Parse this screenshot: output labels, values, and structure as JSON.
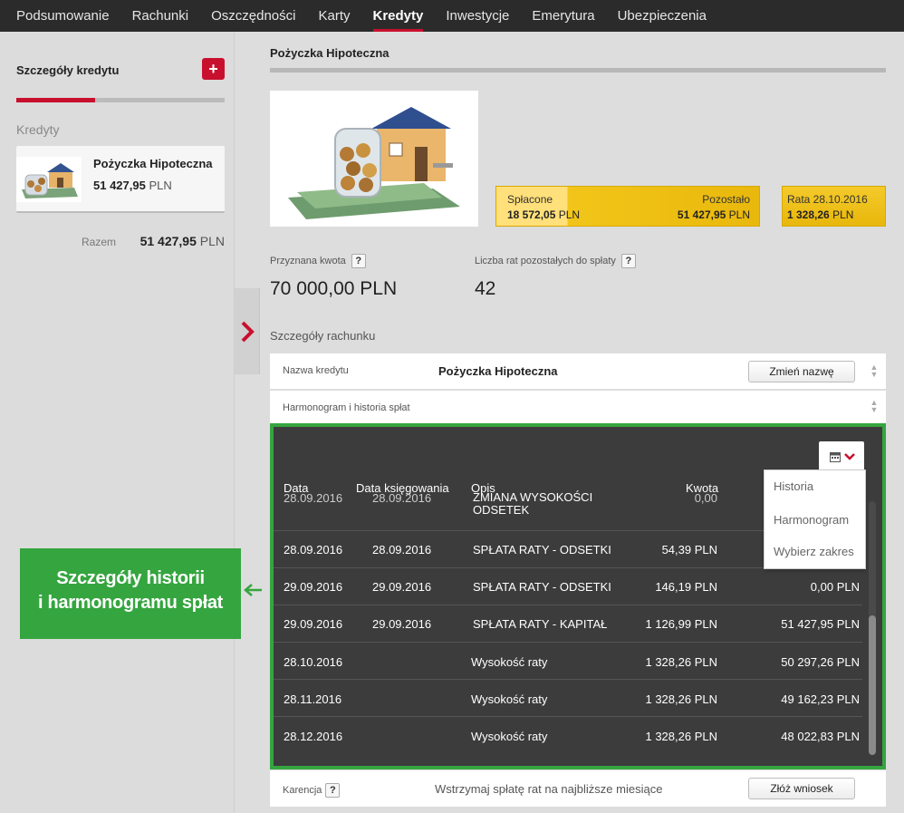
{
  "nav": {
    "items": [
      "Podsumowanie",
      "Rachunki",
      "Oszczędności",
      "Karty",
      "Kredyty",
      "Inwestycje",
      "Emerytura",
      "Ubezpieczenia"
    ],
    "active_index": 4
  },
  "sidebar": {
    "title": "Szczegóły kredytu",
    "add_icon": "plus-icon",
    "add_label": "+",
    "section": "Kredyty",
    "loan": {
      "name": "Pożyczka Hipoteczna",
      "amount": "51 427,95",
      "currency": "PLN"
    },
    "total": {
      "label": "Razem",
      "amount": "51 427,95",
      "currency": "PLN"
    }
  },
  "main": {
    "title": "Pożyczka Hipoteczna",
    "repayment": {
      "paid_label": "Spłacone",
      "paid_amount": "18 572,05",
      "remaining_label": "Pozostało",
      "remaining_amount": "51 427,95",
      "currency": "PLN",
      "paid_fraction": 0.27
    },
    "next_rate": {
      "label": "Rata 28.10.2016",
      "amount": "1 328,26",
      "currency": "PLN"
    },
    "granted": {
      "label": "Przyznana kwota",
      "value": "70 000,00 PLN"
    },
    "installments": {
      "label": "Liczba rat pozostałych do spłaty",
      "value": "42"
    },
    "account_details_label": "Szczegóły rachunku",
    "loan_name": {
      "label": "Nazwa kredytu",
      "value": "Pożyczka Hipoteczna",
      "button": "Zmień nazwę"
    },
    "history_label": "Harmonogram i historia spłat",
    "table": {
      "headers": [
        "Data",
        "Data księgowania",
        "Opis",
        "Kwota"
      ],
      "rows": [
        {
          "date": "28.09.2016",
          "booking": "28.09.2016",
          "desc": "ZMIANA WYSOKOŚCI ODSETEK",
          "amount": "0,00",
          "balance": ""
        },
        {
          "date": "28.09.2016",
          "booking": "28.09.2016",
          "desc": "SPŁATA RATY - ODSETKI",
          "amount": "54,39 PLN",
          "balance": ""
        },
        {
          "date": "29.09.2016",
          "booking": "29.09.2016",
          "desc": "SPŁATA RATY - ODSETKI",
          "amount": "146,19 PLN",
          "balance": "0,00 PLN"
        },
        {
          "date": "29.09.2016",
          "booking": "29.09.2016",
          "desc": "SPŁATA RATY - KAPITAŁ",
          "amount": "1 126,99 PLN",
          "balance": "51 427,95 PLN"
        },
        {
          "date": "28.10.2016",
          "booking": "",
          "desc": "Wysokość raty",
          "amount": "1 328,26 PLN",
          "balance": "50 297,26 PLN"
        },
        {
          "date": "28.11.2016",
          "booking": "",
          "desc": "Wysokość raty",
          "amount": "1 328,26 PLN",
          "balance": "49 162,23 PLN"
        },
        {
          "date": "28.12.2016",
          "booking": "",
          "desc": "Wysokość raty",
          "amount": "1 328,26 PLN",
          "balance": "48 022,83 PLN"
        }
      ]
    },
    "dropdown": [
      "Historia",
      "Harmonogram",
      "Wybierz zakres"
    ],
    "grace": {
      "label": "Karencja",
      "desc": "Wstrzymaj spłatę rat na najbliższe miesiące",
      "button": "Złóż wniosek"
    }
  },
  "callout": {
    "line1": "Szczegóły historii",
    "line2": "i harmonogramu spłat"
  },
  "question_mark": "?",
  "colors": {
    "accent": "#c8102e",
    "highlight": "#35a53f",
    "gold": "#f2c51a"
  }
}
